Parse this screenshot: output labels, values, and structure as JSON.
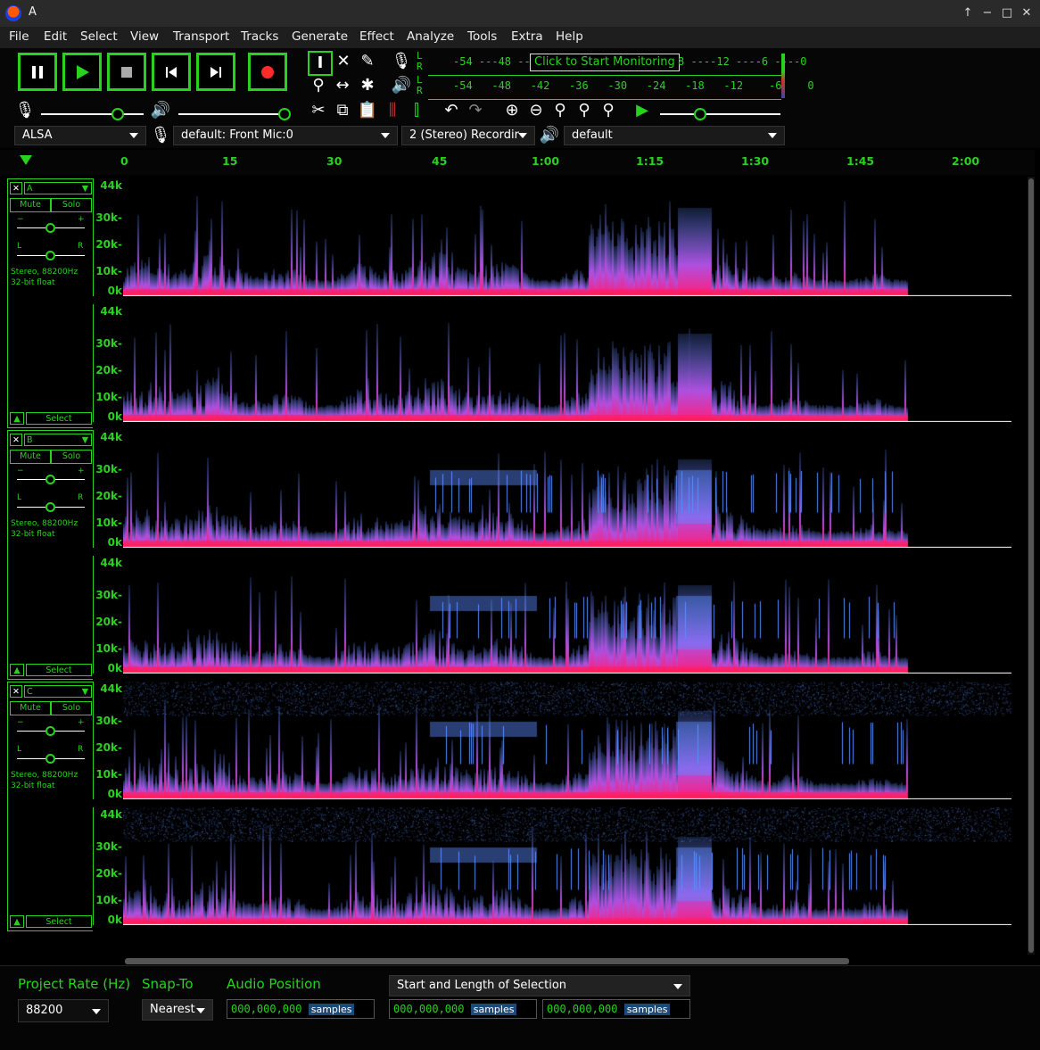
{
  "window": {
    "title": "A"
  },
  "menu": [
    "File",
    "Edit",
    "Select",
    "View",
    "Transport",
    "Tracks",
    "Generate",
    "Effect",
    "Analyze",
    "Tools",
    "Extra",
    "Help"
  ],
  "meters": {
    "rec_scale": "-54   -48    Click to Start Monitoring  8    -12    -6    0",
    "play_scale": "-54   -48   -42   -36   -30   -24   -18   -12    -6    0",
    "monitor_tip": "Click to Start Monitoring",
    "lr": [
      "L",
      "R"
    ]
  },
  "device": {
    "host": "ALSA",
    "input": "default: Front Mic:0",
    "channels": "2 (Stereo) Recordir",
    "output": "default"
  },
  "ruler": {
    "labels": [
      "0",
      "15",
      "30",
      "45",
      "1:00",
      "1:15",
      "1:30",
      "1:45",
      "2:00"
    ]
  },
  "freq_labels": [
    "44k",
    "30k-",
    "20k-",
    "10k-",
    "0k"
  ],
  "tracks": [
    {
      "name": "A",
      "mute": "Mute",
      "solo": "Solo",
      "info1": "Stereo, 88200Hz",
      "info2": "32-bit float",
      "select": "Select",
      "gain_minus": "−",
      "gain_plus": "+",
      "pan_l": "L",
      "pan_r": "R"
    },
    {
      "name": "B",
      "mute": "Mute",
      "solo": "Solo",
      "info1": "Stereo, 88200Hz",
      "info2": "32-bit float",
      "select": "Select",
      "gain_minus": "−",
      "gain_plus": "+",
      "pan_l": "L",
      "pan_r": "R"
    },
    {
      "name": "C",
      "mute": "Mute",
      "solo": "Solo",
      "info1": "Stereo, 88200Hz",
      "info2": "32-bit float",
      "select": "Select",
      "gain_minus": "−",
      "gain_plus": "+",
      "pan_l": "L",
      "pan_r": "R"
    }
  ],
  "bottom": {
    "rate_label": "Project Rate (Hz)",
    "rate_value": "88200",
    "snap_label": "Snap-To",
    "snap_value": "Nearest",
    "pos_label": "Audio Position",
    "sel_mode": "Start and Length of Selection",
    "pos_value": "000,000,000",
    "sel_start": "000,000,000",
    "sel_len": "000,000,000",
    "unit": "samples"
  },
  "colors": {
    "accent": "#28d21e",
    "spec_hi": "#ff1e7a",
    "spec_mid": "#5a8cff"
  }
}
